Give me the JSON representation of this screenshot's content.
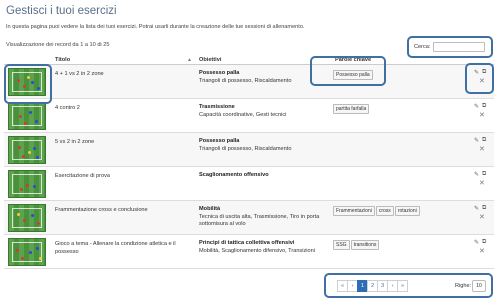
{
  "page": {
    "title": "Gestisci i tuoi esercizi",
    "intro": "In questa pagina puoi vedere la lista dei tuoi esercizi. Potrai usarli durante la creazione delle tue sessioni di allenamento.",
    "records_info": "Visualizzazione dei record da 1 a 10 di 25"
  },
  "search": {
    "label": "Cerca:",
    "value": "",
    "placeholder": ""
  },
  "table": {
    "headers": {
      "title": "Titolo",
      "sort_mark": "▲",
      "objectives": "Obiettivi",
      "keywords": "Parole chiave"
    },
    "rows": [
      {
        "title": "4 + 1 vs 2 in 2 zone",
        "goal_main": "Possesso palla",
        "goal_sub": "Triangoli di possesso, Riscaldamento",
        "tags": [
          "Possesso palla"
        ]
      },
      {
        "title": "4 contro 2",
        "goal_main": "Trasmissione",
        "goal_sub": "Capacità coordinative, Gesti tecnici",
        "tags": [
          "partita farfalla"
        ]
      },
      {
        "title": "5 vs 2 in 2 zone",
        "goal_main": "Possesso palla",
        "goal_sub": "Triangoli di possesso, Riscaldamento",
        "tags": []
      },
      {
        "title": "Esercitazione di prova",
        "goal_main": "Scaglionamento offensivo",
        "goal_sub": "",
        "tags": []
      },
      {
        "title": "Frammentazione cross e conclusione",
        "goal_main": "Mobilità",
        "goal_sub": "Tecnica di uscita alta, Trasmissione, Tiro in porta sottomisura al volo",
        "tags": [
          "Frammentazioni",
          "cross",
          "rotazioni"
        ]
      },
      {
        "title": "Gioco a tema - Allenare la condizione atletica e il possesso",
        "goal_main": "Principi di tattica collettiva offensivi",
        "goal_sub": "Mobilità, Scaglionamento difensivo, Transizioni",
        "tags": [
          "SSG",
          "transitions"
        ]
      }
    ]
  },
  "pagination": {
    "first": "«",
    "prev": "‹",
    "pages": [
      "1",
      "2",
      "3"
    ],
    "next": "›",
    "last": "»",
    "rows_label": "Righe:",
    "rows_value": "10"
  },
  "icons": {
    "edit": "edit-icon",
    "copy": "copy-icon",
    "delete": "delete-icon"
  },
  "colors": {
    "accent": "#2e6db4",
    "highlight": "#3f6fa3",
    "pitch": "#4f9a3f"
  }
}
